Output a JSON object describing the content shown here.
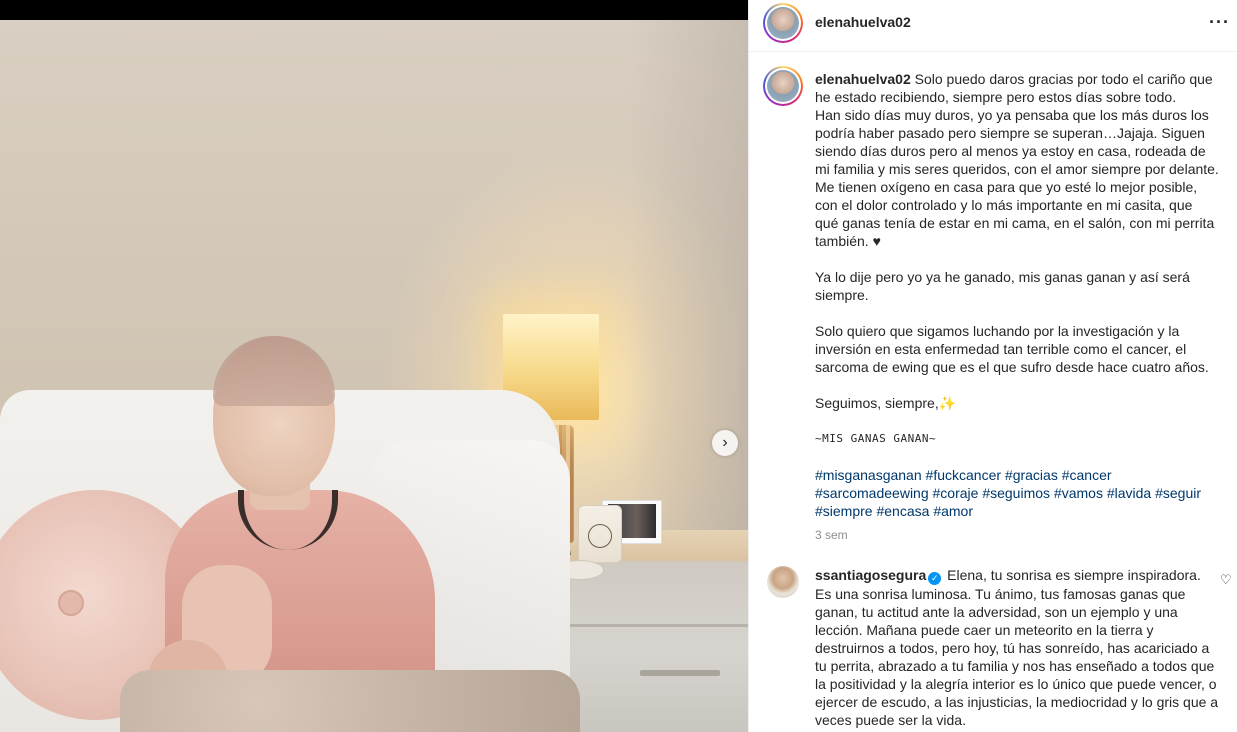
{
  "post": {
    "username": "elenahuelva02",
    "more_icon": "more-options-icon",
    "caption": {
      "username": "elenahuelva02",
      "lines": [
        "Solo puedo daros gracias por todo el cariño que he estado recibiendo, siempre pero estos días sobre todo.",
        "Han sido días muy duros, yo ya pensaba que los más duros los podría haber pasado pero siempre se superan…Jajaja. Siguen siendo días duros pero al menos ya estoy en casa, rodeada de mi familia y mis seres queridos, con el amor siempre por delante. Me tienen oxígeno en casa para que yo esté lo mejor posible, con el dolor controlado y lo más importante en mi casita, que qué ganas tenía de estar en mi cama, en el salón, con mi perrita también. ♥"
      ],
      "paragraph2": "Ya lo dije pero yo ya he ganado, mis ganas ganan y así será siempre.",
      "paragraph3": "Solo quiero que sigamos luchando por la investigación y la inversión en esta enfermedad tan terrible como el cancer, el sarcoma de ewing que es el que sufro desde hace cuatro años.",
      "paragraph4": "Seguimos, siempre,✨",
      "motto": "~MIS GANAS GANAN~",
      "hashtags": [
        "#misganasganan",
        "#fuckcancer",
        "#gracias",
        "#cancer",
        "#sarcomadeewing",
        "#coraje",
        "#seguimos",
        "#vamos",
        "#lavida",
        "#seguir",
        "#siempre",
        "#encasa",
        "#amor"
      ]
    },
    "time_ago": "3 sem"
  },
  "comment": {
    "username": "ssantiagosegura",
    "verified_icon": "verified-badge-icon",
    "text": "Elena, tu sonrisa es siempre inspiradora. Es una sonrisa luminosa. Tu ánimo, tus famosas ganas que ganan, tu actitud ante la adversidad, son un ejemplo y una lección. Mañana puede caer un meteorito en la tierra y destruirnos a todos, pero hoy, tú has sonreído, has acariciado a tu perrita, abrazado a tu familia y nos has enseñado a todos que la positividad y la alegría interior es lo único que puede vencer, o ejercer de escudo, a las injusticias, la mediocridad y lo gris que a veces puede ser la vida.",
    "like_icon": "heart-icon"
  },
  "media": {
    "next_icon": "chevron-right-icon",
    "next_glyph": "›"
  },
  "colors": {
    "link": "#00376b",
    "muted": "#8e8e8e",
    "verified": "#0095f6"
  }
}
